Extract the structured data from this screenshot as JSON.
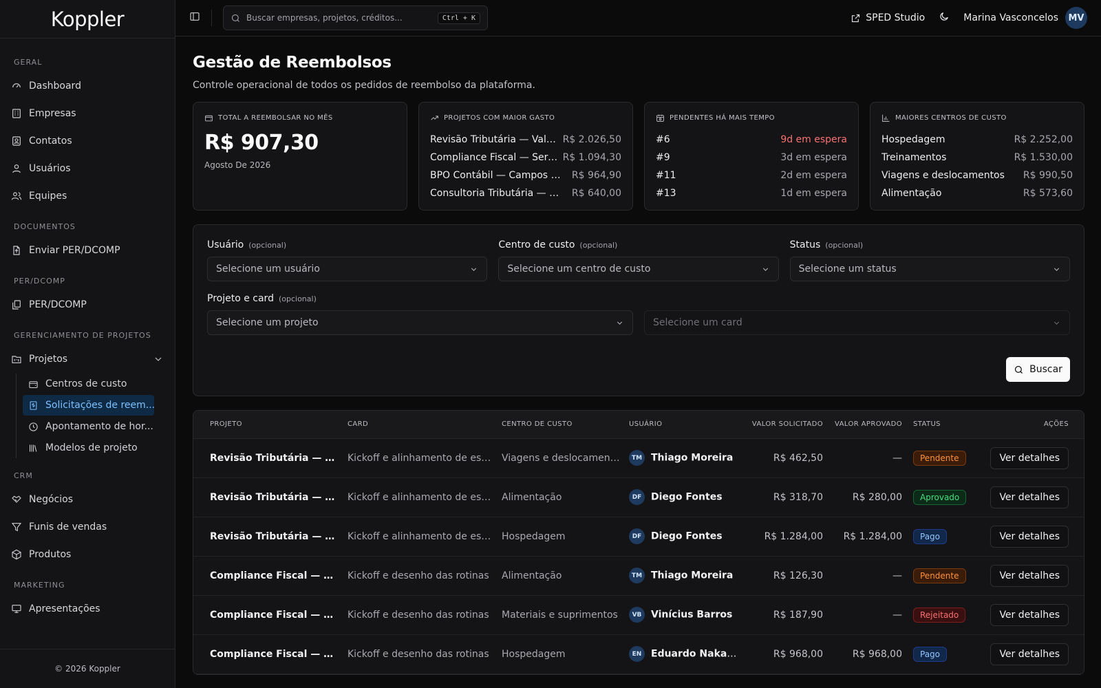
{
  "app": {
    "logo": "Koppler",
    "footer": "© 2026 Koppler"
  },
  "sidebar": {
    "sections": {
      "geral": "GERAL",
      "documentos": "DOCUMENTOS",
      "perdcomp": "PER/DCOMP",
      "projetos": "GERENCIAMENTO DE PROJETOS",
      "crm": "CRM",
      "marketing": "MARKETING"
    },
    "items": {
      "dashboard": "Dashboard",
      "empresas": "Empresas",
      "contatos": "Contatos",
      "usuarios": "Usuários",
      "equipes": "Equipes",
      "enviar": "Enviar PER/DCOMP",
      "perdcomp": "PER/DCOMP",
      "projetos": "Projetos",
      "centros": "Centros de custo",
      "solicitacoes": "Solicitações de reem...",
      "apontamento": "Apontamento de hor...",
      "modelos": "Modelos de projeto",
      "negocios": "Negócios",
      "funis": "Funis de vendas",
      "produtos": "Produtos",
      "apresentacoes": "Apresentações"
    }
  },
  "topbar": {
    "search_placeholder": "Buscar empresas, projetos, créditos...",
    "shortcut": "Ctrl + K",
    "sped": "SPED Studio",
    "user_name": "Marina Vasconcelos",
    "user_initials": "MV"
  },
  "page": {
    "title": "Gestão de Reembolsos",
    "subtitle": "Controle operacional de todos os pedidos de reembolso da plataforma."
  },
  "cards": {
    "total": {
      "label": "TOTAL A REEMBOLSAR NO MÊS",
      "value": "R$ 907,30",
      "month": "Agosto De 2026"
    },
    "projetos": {
      "label": "PROJETOS COM MAIOR GASTO",
      "rows": [
        {
          "name": "Revisão Tributária — Vale V...",
          "value": "R$ 2.026,50"
        },
        {
          "name": "Compliance Fiscal — Serra ...",
          "value": "R$ 1.094,30"
        },
        {
          "name": "BPO Contábil — Campos Ger...",
          "value": "R$ 964,90"
        },
        {
          "name": "Consultoria Tributária — Órion",
          "value": "R$ 640,00"
        }
      ]
    },
    "pendentes": {
      "label": "PENDENTES HÁ MAIS TEMPO",
      "rows": [
        {
          "name": "#6",
          "value": "9d em espera"
        },
        {
          "name": "#9",
          "value": "3d em espera"
        },
        {
          "name": "#11",
          "value": "2d em espera"
        },
        {
          "name": "#13",
          "value": "1d em espera"
        }
      ]
    },
    "centros": {
      "label": "MAIORES CENTROS DE CUSTO",
      "rows": [
        {
          "name": "Hospedagem",
          "value": "R$ 2.252,00"
        },
        {
          "name": "Treinamentos",
          "value": "R$ 1.530,00"
        },
        {
          "name": "Viagens e deslocamentos",
          "value": "R$ 990,50"
        },
        {
          "name": "Alimentação",
          "value": "R$ 573,60"
        }
      ]
    }
  },
  "filters": {
    "optional": "(opcional)",
    "usuario": {
      "label": "Usuário",
      "placeholder": "Selecione um usuário"
    },
    "centro": {
      "label": "Centro de custo",
      "placeholder": "Selecione um centro de custo"
    },
    "status": {
      "label": "Status",
      "placeholder": "Selecione um status"
    },
    "projeto": {
      "label": "Projeto e card",
      "placeholder": "Selecione um projeto"
    },
    "card": {
      "placeholder": "Selecione um card"
    },
    "search_button": "Buscar"
  },
  "table": {
    "headers": [
      "PROJETO",
      "CARD",
      "CENTRO DE CUSTO",
      "USUÁRIO",
      "VALOR SOLICITADO",
      "VALOR APROVADO",
      "STATUS",
      "AÇÕES"
    ],
    "action_label": "Ver detalhes",
    "rows": [
      {
        "projeto": "Revisão Tributária — Vale V...",
        "card": "Kickoff e alinhamento de escopo",
        "centro": "Viagens e deslocamentos",
        "initials": "TM",
        "usuario": "Thiago Moreira",
        "solicitado": "R$ 462,50",
        "aprovado": "—",
        "status": "Pendente"
      },
      {
        "projeto": "Revisão Tributária — Vale V...",
        "card": "Kickoff e alinhamento de escopo",
        "centro": "Alimentação",
        "initials": "DF",
        "usuario": "Diego Fontes",
        "solicitado": "R$ 318,70",
        "aprovado": "R$ 280,00",
        "status": "Aprovado"
      },
      {
        "projeto": "Revisão Tributária — Vale V...",
        "card": "Kickoff e alinhamento de escopo",
        "centro": "Hospedagem",
        "initials": "DF",
        "usuario": "Diego Fontes",
        "solicitado": "R$ 1.284,00",
        "aprovado": "R$ 1.284,00",
        "status": "Pago"
      },
      {
        "projeto": "Compliance Fiscal — Serra ...",
        "card": "Kickoff e desenho das rotinas",
        "centro": "Alimentação",
        "initials": "TM",
        "usuario": "Thiago Moreira",
        "solicitado": "R$ 126,30",
        "aprovado": "—",
        "status": "Pendente"
      },
      {
        "projeto": "Compliance Fiscal — Serra ...",
        "card": "Kickoff e desenho das rotinas",
        "centro": "Materiais e suprimentos",
        "initials": "VB",
        "usuario": "Vinícius Barros",
        "solicitado": "R$ 187,90",
        "aprovado": "—",
        "status": "Rejeitado"
      },
      {
        "projeto": "Compliance Fiscal — Serra ...",
        "card": "Kickoff e desenho das rotinas",
        "centro": "Hospedagem",
        "initials": "EN",
        "usuario": "Eduardo Nakamura",
        "solicitado": "R$ 968,00",
        "aprovado": "R$ 968,00",
        "status": "Pago"
      }
    ]
  },
  "colors": {
    "accent": "#7cc0ff",
    "danger": "#f87171",
    "pending": "#fb923c",
    "approved": "#4ade80",
    "paid": "#93c5fd"
  }
}
